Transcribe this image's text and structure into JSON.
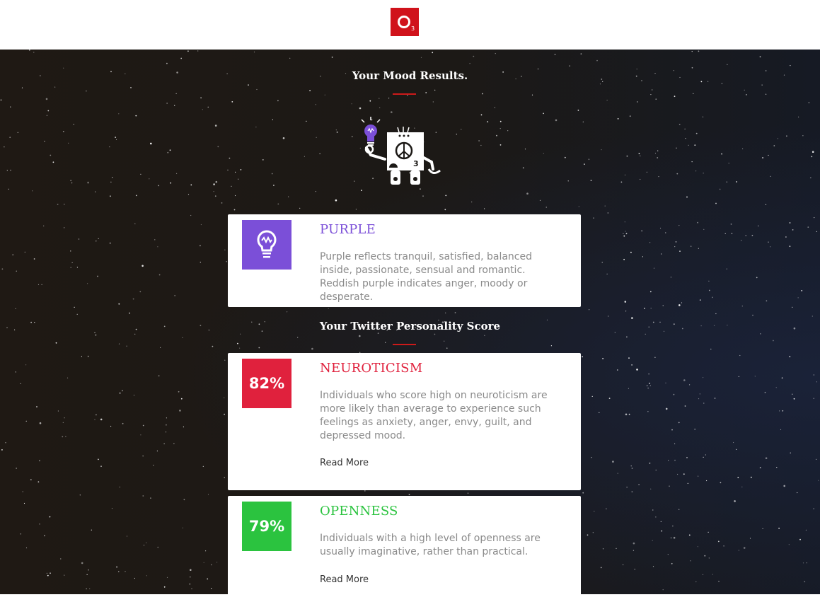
{
  "header": {
    "logo_subscript": "3",
    "logo_color": "#d0121b"
  },
  "mood": {
    "title": "Your Mood Results.",
    "card": {
      "icon": "lightbulb-icon",
      "heading": "PURPLE",
      "heading_color": "#7b4fd8",
      "badge_color": "#7b4fd8",
      "description": "Purple reflects tranquil, satisfied, balanced inside, passionate, sensual and romantic. Reddish purple indicates anger, moody or desperate."
    }
  },
  "mascot": {
    "icon": "robot-mascot-icon",
    "label_number": "3"
  },
  "personality": {
    "title": "Your Twitter Personality Score",
    "traits": [
      {
        "score": "82%",
        "score_fraction": 0.82,
        "heading": "NEUROTICISM",
        "color": "#e0213d",
        "description": "Individuals who score high on neuroticism are more likely than average to experience such feelings as anxiety, anger, envy, guilt, and depressed mood.",
        "link": "Read More"
      },
      {
        "score": "79%",
        "score_fraction": 0.79,
        "heading": "OPENNESS",
        "color": "#2bc33f",
        "description": "Individuals with a high level of openness are usually imaginative, rather than practical.",
        "link": "Read More"
      }
    ]
  }
}
